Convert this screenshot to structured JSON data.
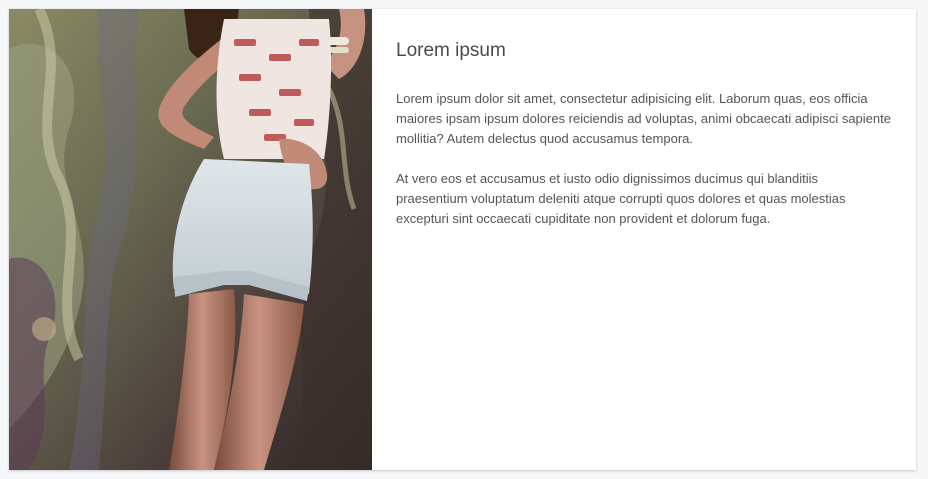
{
  "card": {
    "image_alt": "woman-leaning-on-graffiti-wall",
    "title": "Lorem ipsum",
    "paragraphs": [
      "Lorem ipsum dolor sit amet, consectetur adipisicing elit. Laborum quas, eos officia maiores ipsam ipsum dolores reiciendis ad voluptas, animi obcaecati adipisci sapiente mollitia? Autem delectus quod accusamus tempora.",
      "At vero eos et accusamus et iusto odio dignissimos ducimus qui blanditiis praesentium voluptatum deleniti atque corrupti quos dolores et quas molestias excepturi sint occaecati cupiditate non provident et dolorum fuga."
    ]
  }
}
